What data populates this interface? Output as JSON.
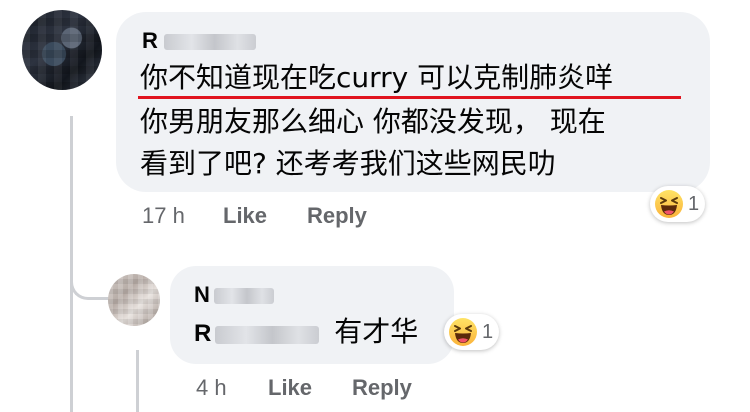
{
  "main_comment": {
    "author_initial": "R",
    "lines": [
      "你不知道现在吃curry 可以克制肺炎咩",
      "你男朋友那么细心 你都没发现， 现在",
      "看到了吧? 还考考我们这些网民叻"
    ],
    "timestamp": "17 h",
    "like_label": "Like",
    "reply_label": "Reply",
    "reaction_icon": "haha-icon",
    "reaction_count": "1",
    "underline_color": "#e0141e"
  },
  "reply_comment": {
    "author_initial": "N",
    "mention_initial": "R",
    "text": "有才华",
    "timestamp": "4 h",
    "like_label": "Like",
    "reply_label": "Reply",
    "reaction_icon": "haha-icon",
    "reaction_count": "1"
  },
  "colors": {
    "bubble": "#f0f2f5",
    "meta_text": "#65676b",
    "thread_line": "#ced0d4"
  }
}
